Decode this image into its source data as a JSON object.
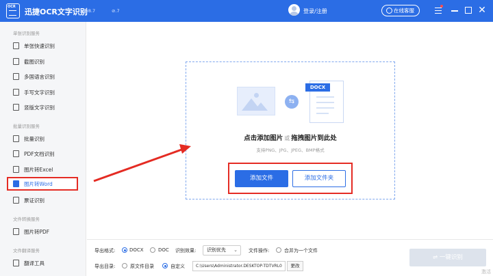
{
  "app": {
    "title": "迅捷OCR文字识别",
    "version": "v8.7",
    "version2": "⊘.7",
    "logo_text": "OCR",
    "login_label": "登录/注册",
    "service_label": "在线客服"
  },
  "sidebar": {
    "sections": [
      {
        "title": "单张识别服务"
      },
      {
        "title": "批量识别服务"
      },
      {
        "title": "文件转换服务"
      },
      {
        "title": "文件翻译服务"
      }
    ],
    "items": [
      {
        "label": "单张快速识别",
        "icon": "image-scan-icon"
      },
      {
        "label": "截图识别",
        "icon": "crop-icon"
      },
      {
        "label": "多国语言识别",
        "icon": "language-icon"
      },
      {
        "label": "手写文字识别",
        "icon": "pen-icon"
      },
      {
        "label": "竖版文字识别",
        "icon": "vertical-text-icon"
      },
      {
        "label": "批量识别",
        "icon": "batch-icon"
      },
      {
        "label": "PDF文档识别",
        "icon": "pdf-doc-icon"
      },
      {
        "label": "图片转Excel",
        "icon": "excel-icon"
      },
      {
        "label": "图片转Word",
        "icon": "word-icon"
      },
      {
        "label": "票证识别",
        "icon": "ticket-icon"
      },
      {
        "label": "图片转PDF",
        "icon": "pdf-icon"
      },
      {
        "label": "翻译工具",
        "icon": "translate-icon"
      }
    ],
    "active_item": "图片转Word"
  },
  "main": {
    "docx_tag": "DOCX",
    "drop_text_1": "点击添加图片",
    "drop_text_or": "或",
    "drop_text_2": "拖拽图片到此处",
    "supported": "支持PNG、JPG、JPEG、BMP格式",
    "add_file": "添加文件",
    "add_folder": "添加文件夹"
  },
  "bottom": {
    "format_label": "导出格式:",
    "format_docx": "DOCX",
    "format_doc": "DOC",
    "effect_label": "识别效果:",
    "effect_value": "识别优先",
    "fileop_label": "文件操作:",
    "merge_label": "合并为一个文件",
    "dir_label": "导出目录:",
    "dir_original": "原文件目录",
    "dir_custom": "自定义",
    "path_value": "C:\\Users\\Administrator.DESKTOP-TDTVRL0",
    "change_label": "更改",
    "recognize_label": "一键识别",
    "watermark": "激活"
  },
  "colors": {
    "accent": "#2b6de5",
    "highlight": "#e42b23",
    "disabled": "#dde3ec"
  }
}
